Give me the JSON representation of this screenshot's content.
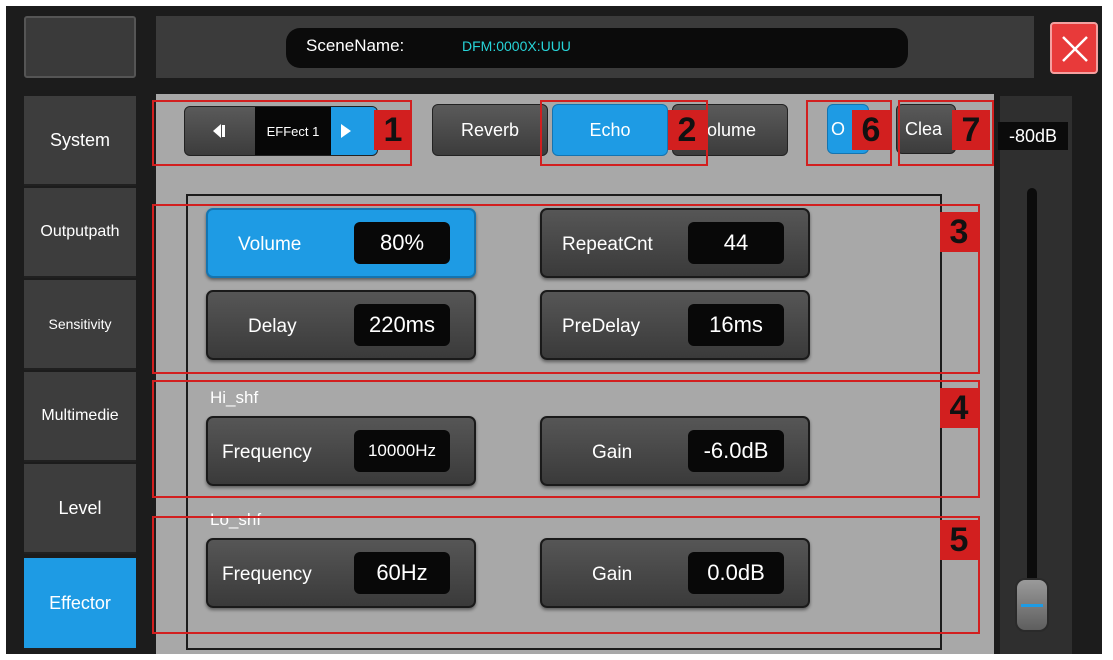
{
  "header": {
    "scene_label": "SceneName:",
    "scene_value": "DFM:0000X:UUU"
  },
  "sidebar": {
    "items": [
      {
        "label": "System"
      },
      {
        "label": "Outputpath"
      },
      {
        "label": "Sensitivity"
      },
      {
        "label": "Multimedie"
      },
      {
        "label": "Level"
      },
      {
        "label": "Effector"
      }
    ],
    "active": "Effector"
  },
  "effect_selector": {
    "label": "EFFect 1"
  },
  "effect_tabs": [
    {
      "label": "Reverb"
    },
    {
      "label": "Echo",
      "active": true
    },
    {
      "label": "olume"
    }
  ],
  "on_button": {
    "label": "O"
  },
  "clear_button": {
    "label": "Clea"
  },
  "params": {
    "volume": {
      "label": "Volume",
      "value": "80%"
    },
    "repeat": {
      "label": "RepeatCnt",
      "value": "44"
    },
    "delay": {
      "label": "Delay",
      "value": "220ms"
    },
    "predelay": {
      "label": "PreDelay",
      "value": "16ms"
    }
  },
  "hi_shelf": {
    "title": "Hi_shf",
    "frequency": {
      "label": "Frequency",
      "value": "10000Hz"
    },
    "gain": {
      "label": "Gain",
      "value": "-6.0dB"
    }
  },
  "lo_shelf": {
    "title": "Lo_shf",
    "frequency": {
      "label": "Frequency",
      "value": "60Hz"
    },
    "gain": {
      "label": "Gain",
      "value": "0.0dB"
    }
  },
  "output_slider": {
    "label": "-80dB",
    "level": 0.06
  },
  "annotations": [
    "1",
    "2",
    "3",
    "4",
    "5",
    "6",
    "7"
  ],
  "colors": {
    "accent": "#1e9be4",
    "annotation": "#d21f1f",
    "scene_text": "#27d4d8",
    "close": "#e83a3a"
  }
}
